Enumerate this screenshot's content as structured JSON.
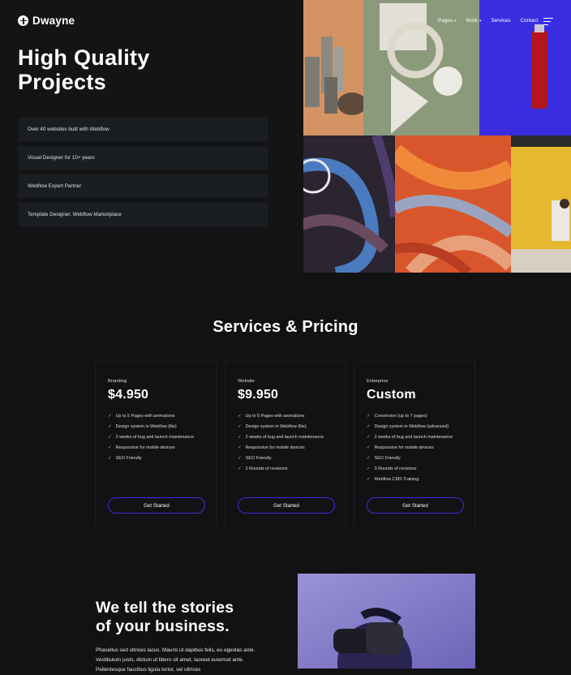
{
  "brand": {
    "name": "Dwayne"
  },
  "nav": {
    "items": [
      {
        "label": "Pages",
        "has_dropdown": true
      },
      {
        "label": "Work",
        "has_dropdown": true
      },
      {
        "label": "Services",
        "has_dropdown": false
      },
      {
        "label": "Contact",
        "has_dropdown": false
      }
    ],
    "menu_icon": "hamburger-menu-icon"
  },
  "hero": {
    "title": "High Quality\nProjects",
    "features": [
      "Over 40 websites built with Webflow",
      "Visual Designer for 10+ years",
      "Webflow Expert Partner",
      "Template Designer, Webflow Marketplace"
    ]
  },
  "pricing": {
    "title": "Services & Pricing",
    "plans": [
      {
        "category": "Branding",
        "price": "$4.950",
        "features": [
          "Up to 5 Pages with animations",
          "Design system in Webflow (lite)",
          "2 weeks of bug and launch maintenance",
          "Responsive for mobile devices",
          "SEO Friendly"
        ],
        "button": "Get Started"
      },
      {
        "category": "Website",
        "price": "$9.950",
        "features": [
          "Up to 5 Pages with animations",
          "Design system in Webflow (lite)",
          "2 weeks of bug and launch maintenance",
          "Responsive for mobile devices",
          "SEO Friendly",
          "2 Rounds of revisions"
        ],
        "button": "Get Started"
      },
      {
        "category": "Enterprise",
        "price": "Custom",
        "features": [
          "Conversion (up to 7 pages)",
          "Design system in Webflow (advanced)",
          "2 weeks of bug and launch maintenance",
          "Responsive for mobile devices",
          "SEO Friendly",
          "3 Rounds of revisions",
          "Webflow CMS Training"
        ],
        "button": "Get Started"
      }
    ]
  },
  "story": {
    "title": "We tell the stories\nof your business.",
    "text": "Phasellus sed ultrices lacus. Mauris ut dapibus felis, eu egestas ante. Vestibulum justo, dictum ut libero sit amet, laoreet euismod ante. Pellentesque faucibus ligula tortor, vel ultrices"
  },
  "colors": {
    "background": "#121214",
    "panel": "#1b1e21",
    "accent": "#3c2bd6"
  }
}
